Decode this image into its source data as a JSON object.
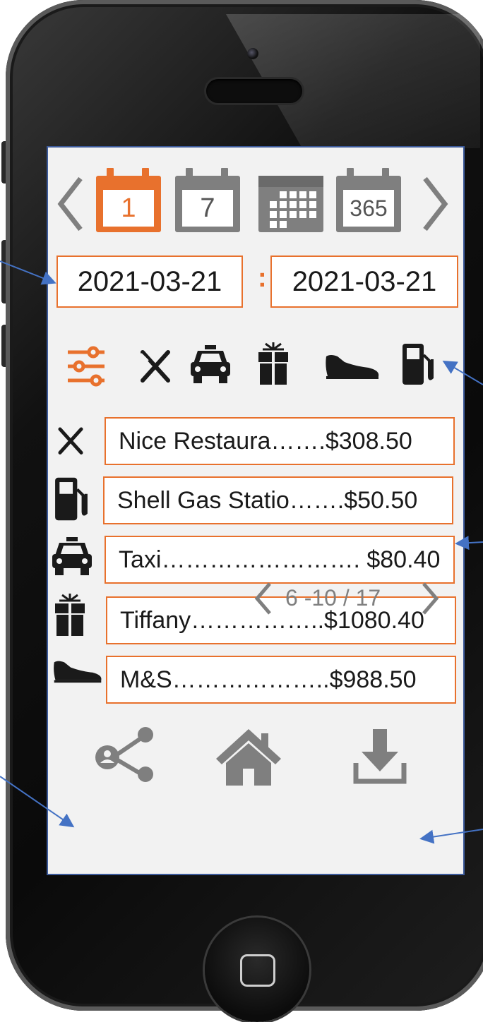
{
  "screen": {
    "period_tabs": [
      {
        "icon": "calendar-day-icon",
        "label": "1",
        "selected": true
      },
      {
        "icon": "calendar-week-icon",
        "label": "7",
        "selected": false
      },
      {
        "icon": "calendar-month-icon",
        "label": "",
        "selected": false
      },
      {
        "icon": "calendar-year-icon",
        "label": "365",
        "selected": false
      }
    ],
    "date_from": "2021-03-21",
    "date_separator": ":",
    "date_to": "2021-03-21",
    "categories": [
      {
        "icon": "filter-sliders-icon",
        "selected": true
      },
      {
        "icon": "restaurant-icon",
        "selected": false
      },
      {
        "icon": "taxi-icon",
        "selected": false
      },
      {
        "icon": "gift-icon",
        "selected": false
      },
      {
        "icon": "shoe-icon",
        "selected": false
      },
      {
        "icon": "gas-pump-icon",
        "selected": false
      }
    ],
    "expenses": [
      {
        "icon": "restaurant-icon",
        "text": "Nice Restaura…….$308.50"
      },
      {
        "icon": "gas-pump-icon",
        "text": "Shell Gas Statio…….$50.50"
      },
      {
        "icon": "taxi-icon",
        "text": "Taxi……………………. $80.40"
      },
      {
        "icon": "gift-icon",
        "text": "Tiffany……………..$1080.40"
      },
      {
        "icon": "shoe-icon",
        "text": "M&S………………..$988.50"
      }
    ],
    "pager": {
      "text": "6 -10 / 17"
    },
    "bottom_nav": [
      {
        "icon": "share-icon"
      },
      {
        "icon": "home-icon"
      },
      {
        "icon": "download-icon"
      }
    ]
  },
  "colors": {
    "accent": "#e8712d",
    "muted": "#7f7f7f",
    "icon": "#1a1a1a",
    "screen_bg": "#f2f2f2",
    "callout": "#4472c4"
  }
}
